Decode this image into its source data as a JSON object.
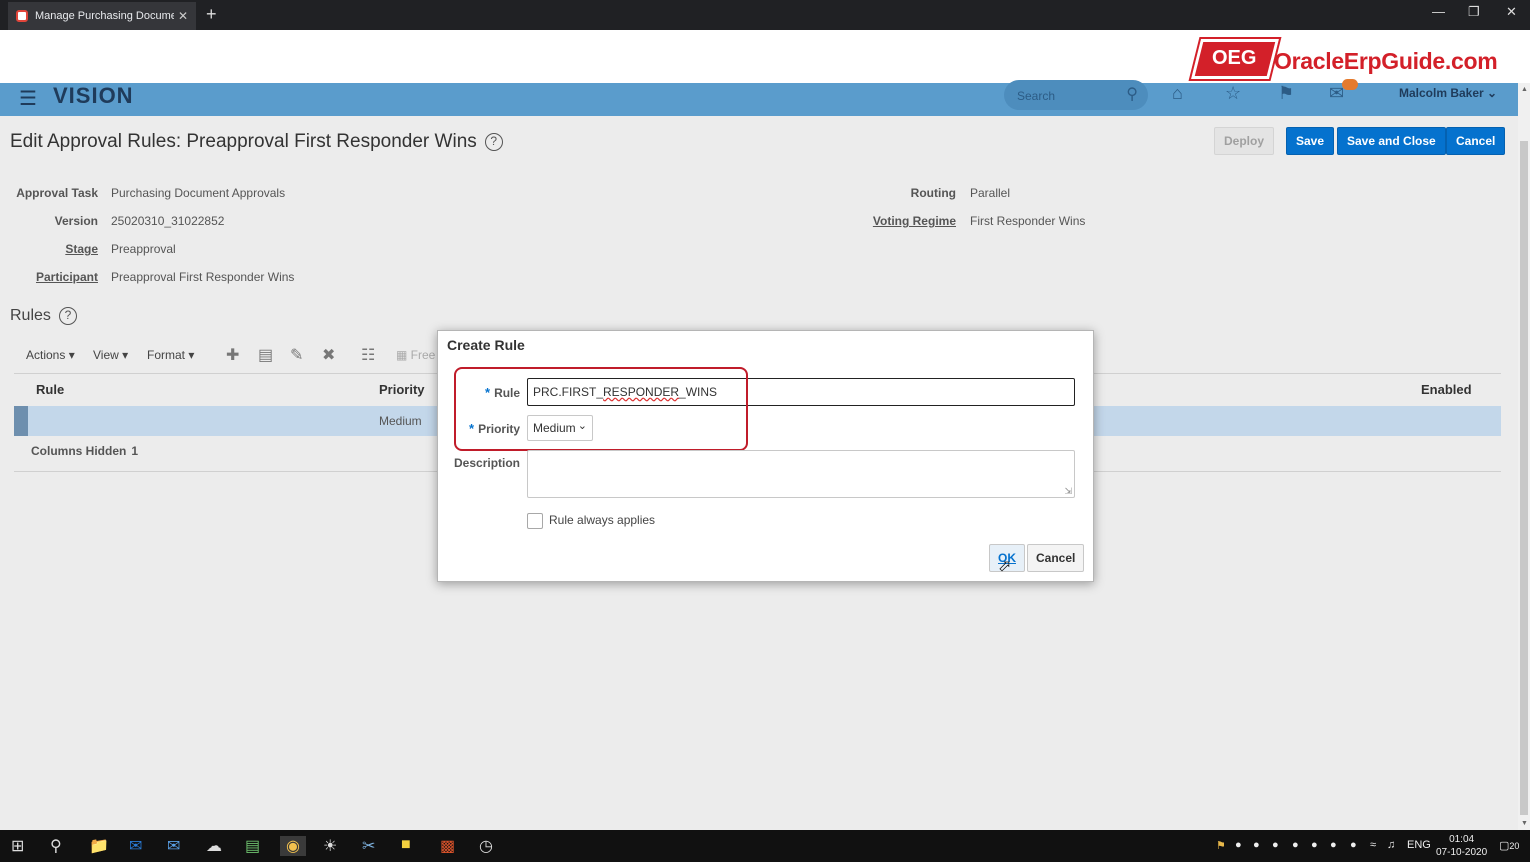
{
  "browser": {
    "tab_title": "Manage Purchasing Document A",
    "tab_close": "✕",
    "new_tab": "+",
    "minimize": "—",
    "restore": "❐",
    "close": "✕"
  },
  "banner": {
    "badge": "OEG",
    "site": "OracleErpGuide.com",
    "brand_color": "#d32029"
  },
  "header": {
    "brand": "VISION",
    "search_placeholder": "Search",
    "user": "Malcolm Baker",
    "bar_color": "#5a9ccc"
  },
  "page": {
    "title": "Edit Approval Rules: Preapproval First Responder Wins",
    "help": "?",
    "buttons": {
      "deploy": "Deploy",
      "save": "Save",
      "save_close": "Save and Close",
      "cancel": "Cancel"
    },
    "fields": {
      "approval_task_label": "Approval Task",
      "approval_task": "Purchasing Document Approvals",
      "version_label": "Version",
      "version": "25020310_31022852",
      "stage_label": "Stage",
      "stage": "Preapproval",
      "participant_label": "Participant",
      "participant": "Preapproval First Responder Wins",
      "routing_label": "Routing",
      "routing": "Parallel",
      "voting_label": "Voting Regime",
      "voting": "First Responder Wins"
    }
  },
  "rules": {
    "title": "Rules",
    "help": "?",
    "toolbar": {
      "actions": "Actions",
      "view": "View",
      "format": "Format",
      "freeze": "Free"
    },
    "columns": {
      "rule": "Rule",
      "priority": "Priority",
      "enabled": "Enabled"
    },
    "rows": [
      {
        "rule": "",
        "priority": "Medium"
      }
    ],
    "columns_hidden_label": "Columns Hidden",
    "columns_hidden_count": "1"
  },
  "dialog": {
    "title": "Create Rule",
    "rule_label": "Rule",
    "rule_value_prefix": "PRC.FIRST_",
    "rule_value_mid": "RESPONDER",
    "rule_value_suffix": "_WINS",
    "priority_label": "Priority",
    "priority_value": "Medium",
    "description_label": "Description",
    "always_applies_label": "Rule always applies",
    "ok": "OK",
    "cancel": "Cancel",
    "required_mark": "*"
  },
  "taskbar": {
    "language": "ENG",
    "time": "01:04",
    "date": "07-10-2020",
    "notifications": "20"
  }
}
